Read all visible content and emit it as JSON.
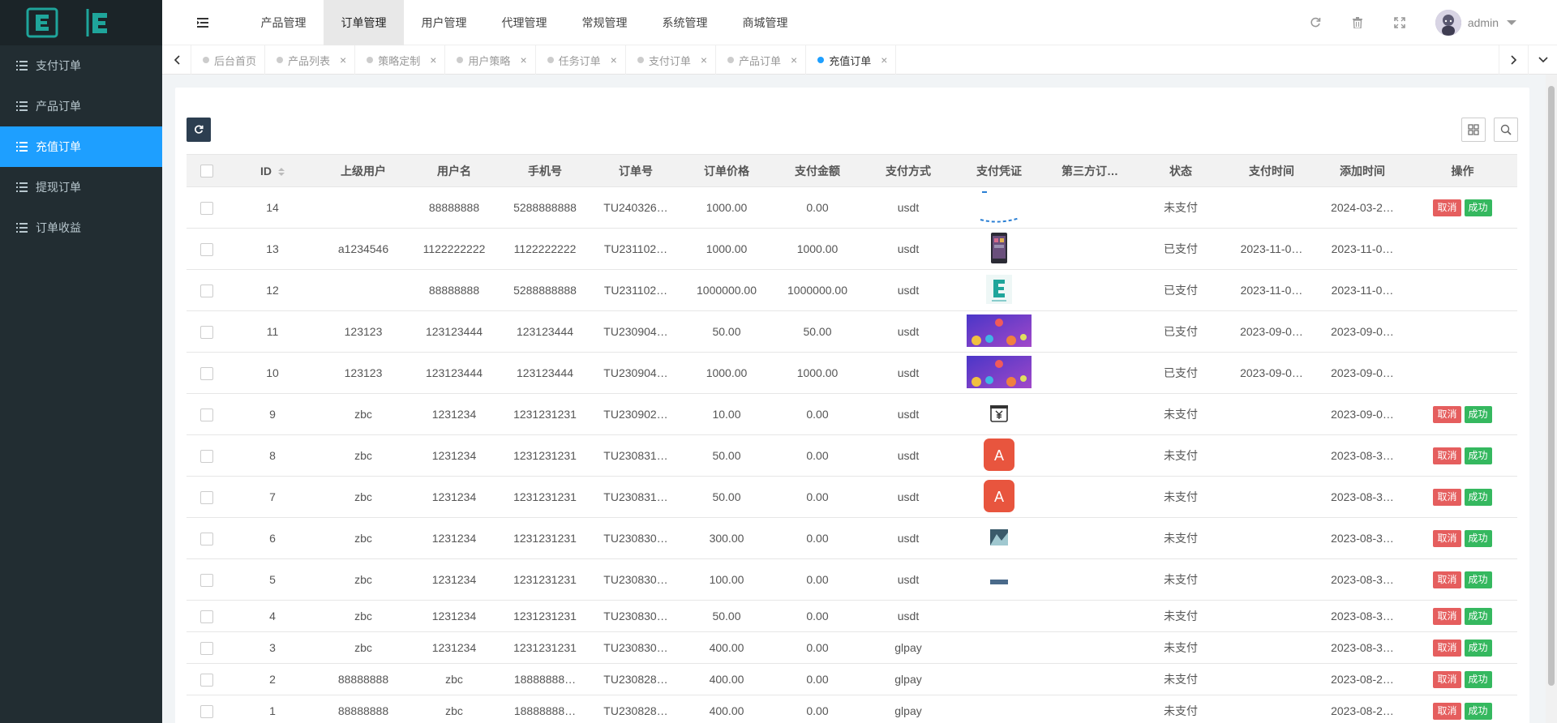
{
  "sidebar": {
    "logo_letters": [
      "E",
      "E"
    ],
    "items": [
      {
        "label": "支付订单"
      },
      {
        "label": "产品订单"
      },
      {
        "label": "充值订单"
      },
      {
        "label": "提现订单"
      },
      {
        "label": "订单收益"
      }
    ],
    "active_index": 2
  },
  "topnav": {
    "items": [
      {
        "label": "产品管理"
      },
      {
        "label": "订单管理"
      },
      {
        "label": "用户管理"
      },
      {
        "label": "代理管理"
      },
      {
        "label": "常规管理"
      },
      {
        "label": "系统管理"
      },
      {
        "label": "商城管理"
      }
    ],
    "active_index": 1,
    "user_name": "admin"
  },
  "tabs": [
    {
      "label": "后台首页",
      "closable": false
    },
    {
      "label": "产品列表",
      "closable": true
    },
    {
      "label": "策略定制",
      "closable": true
    },
    {
      "label": "用户策略",
      "closable": true
    },
    {
      "label": "任务订单",
      "closable": true
    },
    {
      "label": "支付订单",
      "closable": true
    },
    {
      "label": "产品订单",
      "closable": true
    },
    {
      "label": "充值订单",
      "closable": true,
      "active": true
    }
  ],
  "table": {
    "headers": [
      "ID",
      "上级用户",
      "用户名",
      "手机号",
      "订单号",
      "订单价格",
      "支付金额",
      "支付方式",
      "支付凭证",
      "第三方订…",
      "状态",
      "支付时间",
      "添加时间",
      "操作"
    ],
    "cancel_label": "取消",
    "success_label": "成功",
    "rows": [
      {
        "id": "14",
        "parent": "",
        "username": "88888888",
        "phone": "5288888888",
        "order": "TU240326…",
        "price": "1000.00",
        "paid": "0.00",
        "method": "usdt",
        "proof": "partial",
        "third": "",
        "status": "未支付",
        "pay_time": "",
        "add_time": "2024-03-2…",
        "actions": true
      },
      {
        "id": "13",
        "parent": "a1234546",
        "username": "1122222222",
        "phone": "1122222222",
        "order": "TU231102…",
        "price": "1000.00",
        "paid": "1000.00",
        "method": "usdt",
        "proof": "phone",
        "third": "",
        "status": "已支付",
        "pay_time": "2023-11-0…",
        "add_time": "2023-11-0…",
        "actions": false
      },
      {
        "id": "12",
        "parent": "",
        "username": "88888888",
        "phone": "5288888888",
        "order": "TU231102…",
        "price": "1000000.00",
        "paid": "1000000.00",
        "method": "usdt",
        "proof": "elogo",
        "third": "",
        "status": "已支付",
        "pay_time": "2023-11-0…",
        "add_time": "2023-11-0…",
        "actions": false
      },
      {
        "id": "11",
        "parent": "123123",
        "username": "123123444",
        "phone": "123123444",
        "order": "TU230904…",
        "price": "50.00",
        "paid": "50.00",
        "method": "usdt",
        "proof": "banner",
        "third": "",
        "status": "已支付",
        "pay_time": "2023-09-0…",
        "add_time": "2023-09-0…",
        "actions": false
      },
      {
        "id": "10",
        "parent": "123123",
        "username": "123123444",
        "phone": "123123444",
        "order": "TU230904…",
        "price": "1000.00",
        "paid": "1000.00",
        "method": "usdt",
        "proof": "banner",
        "third": "",
        "status": "已支付",
        "pay_time": "2023-09-0…",
        "add_time": "2023-09-0…",
        "actions": false
      },
      {
        "id": "9",
        "parent": "zbc",
        "username": "1231234",
        "phone": "1231231231",
        "order": "TU230902…",
        "price": "10.00",
        "paid": "0.00",
        "method": "usdt",
        "proof": "yen",
        "third": "",
        "status": "未支付",
        "pay_time": "",
        "add_time": "2023-09-0…",
        "actions": true
      },
      {
        "id": "8",
        "parent": "zbc",
        "username": "1231234",
        "phone": "1231231231",
        "order": "TU230831…",
        "price": "50.00",
        "paid": "0.00",
        "method": "usdt",
        "proof": "a-icon",
        "third": "",
        "status": "未支付",
        "pay_time": "",
        "add_time": "2023-08-3…",
        "actions": true
      },
      {
        "id": "7",
        "parent": "zbc",
        "username": "1231234",
        "phone": "1231231231",
        "order": "TU230831…",
        "price": "50.00",
        "paid": "0.00",
        "method": "usdt",
        "proof": "a-icon",
        "third": "",
        "status": "未支付",
        "pay_time": "",
        "add_time": "2023-08-3…",
        "actions": true
      },
      {
        "id": "6",
        "parent": "zbc",
        "username": "1231234",
        "phone": "1231231231",
        "order": "TU230830…",
        "price": "300.00",
        "paid": "0.00",
        "method": "usdt",
        "proof": "small",
        "third": "",
        "status": "未支付",
        "pay_time": "",
        "add_time": "2023-08-3…",
        "actions": true
      },
      {
        "id": "5",
        "parent": "zbc",
        "username": "1231234",
        "phone": "1231231231",
        "order": "TU230830…",
        "price": "100.00",
        "paid": "0.00",
        "method": "usdt",
        "proof": "tiny",
        "third": "",
        "status": "未支付",
        "pay_time": "",
        "add_time": "2023-08-3…",
        "actions": true
      },
      {
        "id": "4",
        "parent": "zbc",
        "username": "1231234",
        "phone": "1231231231",
        "order": "TU230830…",
        "price": "50.00",
        "paid": "0.00",
        "method": "usdt",
        "proof": "",
        "third": "",
        "status": "未支付",
        "pay_time": "",
        "add_time": "2023-08-3…",
        "actions": true
      },
      {
        "id": "3",
        "parent": "zbc",
        "username": "1231234",
        "phone": "1231231231",
        "order": "TU230830…",
        "price": "400.00",
        "paid": "0.00",
        "method": "glpay",
        "proof": "",
        "third": "",
        "status": "未支付",
        "pay_time": "",
        "add_time": "2023-08-3…",
        "actions": true
      },
      {
        "id": "2",
        "parent": "88888888",
        "username": "zbc",
        "phone": "18888888…",
        "order": "TU230828…",
        "price": "400.00",
        "paid": "0.00",
        "method": "glpay",
        "proof": "",
        "third": "",
        "status": "未支付",
        "pay_time": "",
        "add_time": "2023-08-2…",
        "actions": true
      },
      {
        "id": "1",
        "parent": "88888888",
        "username": "zbc",
        "phone": "18888888…",
        "order": "TU230828…",
        "price": "400.00",
        "paid": "0.00",
        "method": "glpay",
        "proof": "",
        "third": "",
        "status": "未支付",
        "pay_time": "",
        "add_time": "2023-08-2…",
        "actions": true
      }
    ]
  },
  "colors": {
    "sidebar_bg": "#222d32",
    "accent": "#1e9fff",
    "cancel": "#e55e5e",
    "success": "#35b85f",
    "logo_teal": "#1fa59b"
  }
}
